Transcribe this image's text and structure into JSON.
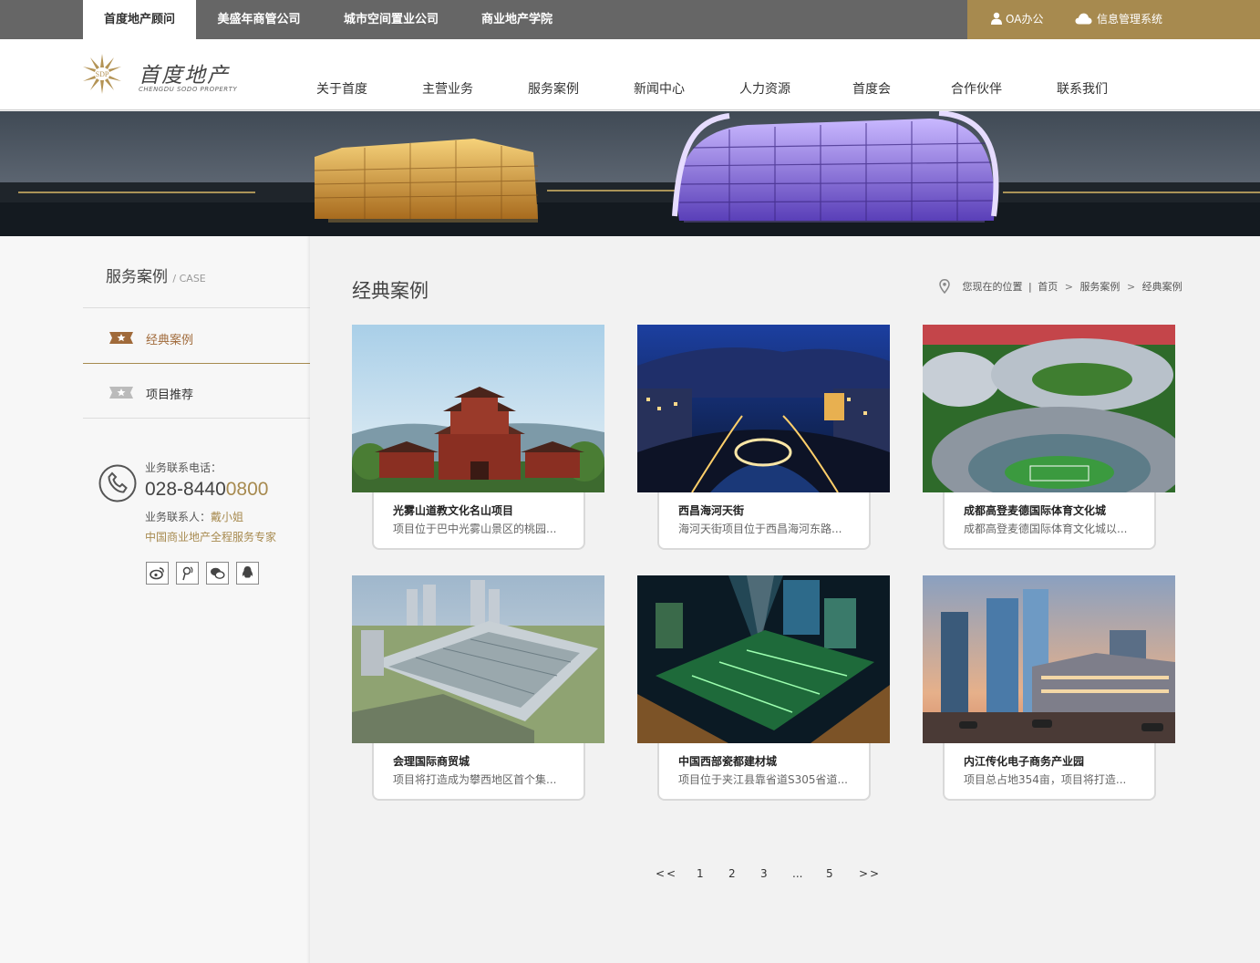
{
  "topbar": {
    "tabs": [
      {
        "label": "首度地产顾问",
        "active": true
      },
      {
        "label": "美盛年商管公司"
      },
      {
        "label": "城市空间置业公司"
      },
      {
        "label": "商业地产学院"
      }
    ],
    "oa_label": "OA办公",
    "info_label": "信息管理系统"
  },
  "header": {
    "logo_mark": "SDP",
    "logo_cn": "首度地产",
    "logo_en": "CHENGDU SODO PROPERTY",
    "nav": [
      "关于首度",
      "主营业务",
      "服务案例",
      "新闻中心",
      "人力资源",
      "首度会",
      "合作伙伴",
      "联系我们"
    ]
  },
  "sidebar": {
    "title": "服务案例",
    "title_en": "/ CASE",
    "items": [
      {
        "label": "经典案例",
        "active": true
      },
      {
        "label": "项目推荐"
      }
    ],
    "contact": {
      "phone_label": "业务联系电话：",
      "phone_main": "028-8440",
      "phone_tail": "0800",
      "person_label": "业务联系人：",
      "person_name": "戴小姐",
      "slogan": "中国商业地产全程服务专家"
    },
    "social_icons": [
      "weibo-icon",
      "tencent-weibo-icon",
      "wechat-icon",
      "qq-icon"
    ]
  },
  "main": {
    "title": "经典案例",
    "breadcrumb": {
      "prefix": "您现在的位置",
      "divider": "|",
      "home": "首页",
      "sep": ">",
      "level1": "服务案例",
      "current": "经典案例"
    },
    "cases": [
      {
        "title": "光雾山道教文化名山项目",
        "desc": "项目位于巴中光雾山景区的桃园..."
      },
      {
        "title": "西昌海河天街",
        "desc": "海河天街项目位于西昌海河东路..."
      },
      {
        "title": "成都高登麦德国际体育文化城",
        "desc": "成都高登麦德国际体育文化城以..."
      },
      {
        "title": "会理国际商贸城",
        "desc": "项目将打造成为攀西地区首个集..."
      },
      {
        "title": "中国西部瓷都建材城",
        "desc": "项目位于夹江县靠省道S305省道..."
      },
      {
        "title": "内江传化电子商务产业园",
        "desc": "项目总占地354亩，项目将打造..."
      }
    ]
  },
  "pagination": {
    "prev": "<<",
    "pages": [
      "1",
      "2",
      "3",
      "...",
      "5"
    ],
    "next": ">>"
  },
  "colors": {
    "accent_gold": "#a78a4f",
    "topbar_gray": "#666666",
    "page_bg": "#f2f2f2"
  }
}
